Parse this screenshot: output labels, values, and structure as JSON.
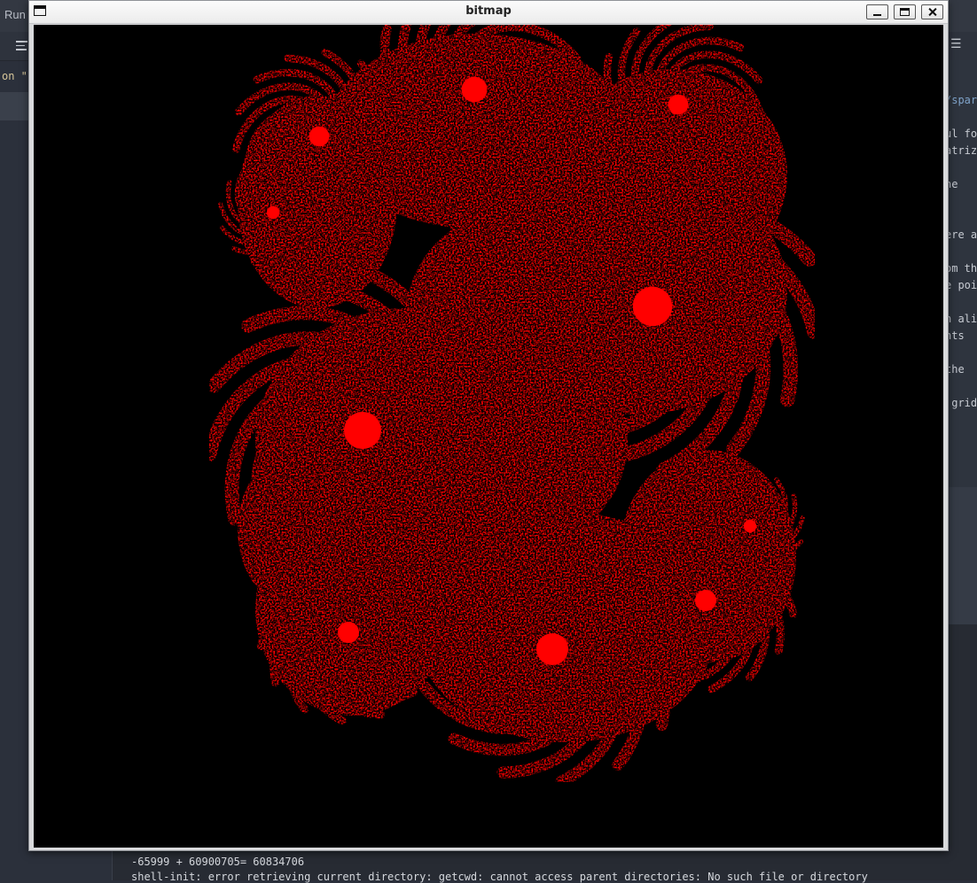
{
  "background_app": {
    "run_label": "Run",
    "code_prefix": "on \"n",
    "right_snippets": [
      "/spar",
      "ul fo",
      "atriz",
      "he",
      "ere a",
      "om th",
      "e poi",
      "h ali",
      "nts",
      "the",
      " grid"
    ],
    "terminal_lines": [
      "-65999 + 60900705= 60834706",
      "shell-init: error retrieving current directory: getcwd: cannot access parent directories: No such file or directory"
    ]
  },
  "window": {
    "title": "bitmap",
    "buttons": {
      "minimize": "minimize",
      "maximize": "maximize",
      "close": "close"
    }
  },
  "image": {
    "description_icon": "fractal-image",
    "background_color": "#000000",
    "fractal_color": "#ff0000"
  }
}
